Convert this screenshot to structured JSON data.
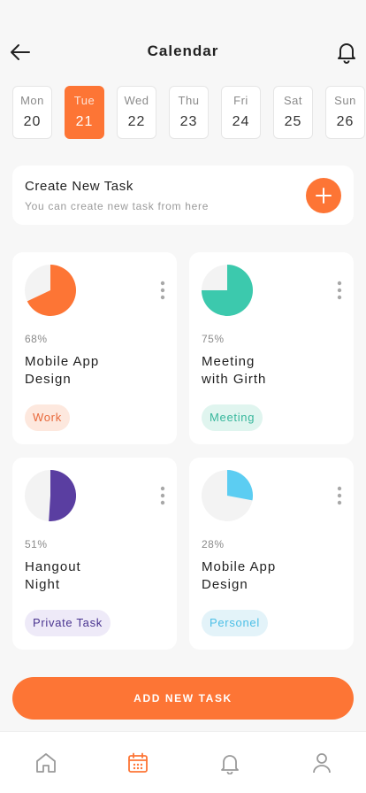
{
  "header": {
    "title": "Calendar",
    "back_icon": "arrow-left-icon",
    "bell_icon": "bell-icon"
  },
  "days": [
    {
      "name": "Mon",
      "num": "20",
      "active": false
    },
    {
      "name": "Tue",
      "num": "21",
      "active": true
    },
    {
      "name": "Wed",
      "num": "22",
      "active": false
    },
    {
      "name": "Thu",
      "num": "23",
      "active": false
    },
    {
      "name": "Fri",
      "num": "24",
      "active": false
    },
    {
      "name": "Sat",
      "num": "25",
      "active": false
    },
    {
      "name": "Sun",
      "num": "26",
      "active": false
    }
  ],
  "create_task": {
    "title": "Create New Task",
    "subtitle": "You can create new task from here",
    "icon": "plus-icon"
  },
  "tasks": [
    {
      "percent": "68%",
      "progress": 0.68,
      "title_line1": "Mobile App",
      "title_line2": "Design",
      "tag": "Work",
      "color": "#fd7535",
      "tag_bg": "#fde8de",
      "tag_color": "#e8683a"
    },
    {
      "percent": "75%",
      "progress": 0.75,
      "title_line1": "Meeting",
      "title_line2": "with Girth",
      "tag": "Meeting",
      "color": "#3cc9ad",
      "tag_bg": "#e0f5ef",
      "tag_color": "#37b79c"
    },
    {
      "percent": "51%",
      "progress": 0.51,
      "title_line1": "Hangout",
      "title_line2": "Night",
      "tag": "Private Task",
      "color": "#5a3ea1",
      "tag_bg": "#eeeaf8",
      "tag_color": "#4a3590"
    },
    {
      "percent": "28%",
      "progress": 0.28,
      "title_line1": "Mobile App",
      "title_line2": "Design",
      "tag": "Personel",
      "color": "#5ccdf2",
      "tag_bg": "#e3f3f9",
      "tag_color": "#4cbfe6"
    }
  ],
  "add_button": {
    "label": "ADD NEW TASK"
  },
  "tab_bar": {
    "items": [
      "home-icon",
      "calendar-icon",
      "bell-icon",
      "user-icon"
    ],
    "active_color": "#fd7535",
    "inactive_color": "#9a9a9a"
  },
  "colors": {
    "accent": "#fd7535",
    "background": "#f7f7f7",
    "card": "#ffffff"
  }
}
